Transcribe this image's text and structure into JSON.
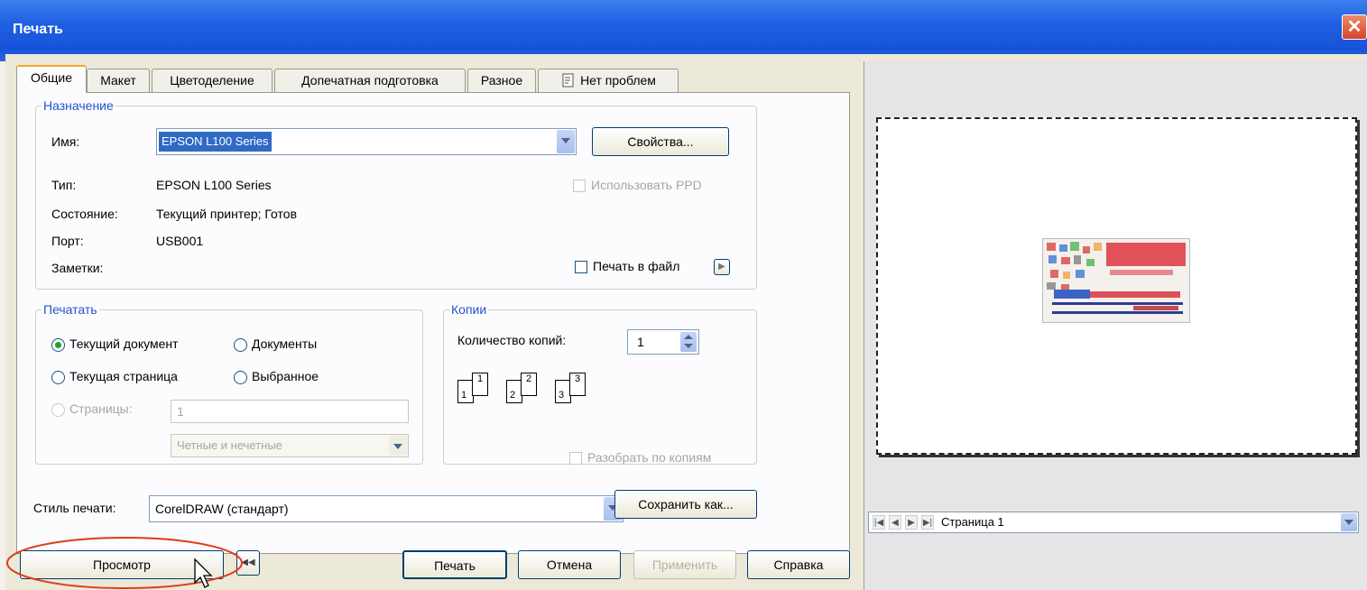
{
  "window": {
    "title": "Печать",
    "close_glyph": "✕"
  },
  "tabs": [
    {
      "label": "Общие"
    },
    {
      "label": "Макет"
    },
    {
      "label": "Цветоделение"
    },
    {
      "label": "Допечатная подготовка"
    },
    {
      "label": "Разное"
    },
    {
      "label": "Нет проблем",
      "icon": "checklist-icon"
    }
  ],
  "destination": {
    "group": "Назначение",
    "name_label": "Имя:",
    "name_value": "EPSON L100 Series",
    "properties_button": "Свойства...",
    "type_label": "Тип:",
    "type_value": "EPSON L100 Series",
    "use_ppd": "Использовать PPD",
    "state_label": "Состояние:",
    "state_value": "Текущий принтер; Готов",
    "port_label": "Порт:",
    "port_value": "USB001",
    "notes_label": "Заметки:",
    "print_to_file": "Печать в файл"
  },
  "print_range": {
    "group": "Печатать",
    "current_document": "Текущий документ",
    "documents": "Документы",
    "current_page": "Текущая страница",
    "selection": "Выбранное",
    "pages": "Страницы:",
    "pages_value": "1",
    "odd_even": "Четные и нечетные"
  },
  "copies": {
    "group": "Копии",
    "count_label": "Количество копий:",
    "count_value": "1",
    "collate": "Разобрать по копиям",
    "icons": [
      "1",
      "1",
      "2",
      "2",
      "3",
      "3"
    ]
  },
  "style": {
    "label": "Стиль печати:",
    "value": "CorelDRAW (стандарт)",
    "save_as": "Сохранить как..."
  },
  "buttons": {
    "preview": "Просмотр",
    "preview_toggle": "◀◀",
    "print": "Печать",
    "cancel": "Отмена",
    "apply": "Применить",
    "help": "Справка"
  },
  "preview_nav": {
    "page_label": "Страница 1"
  },
  "colors": {
    "accent": "#316ac5",
    "title_bar": "#1e5fe1",
    "annotation": "#e03a1e",
    "selected_text_bg": "#316ac5"
  }
}
